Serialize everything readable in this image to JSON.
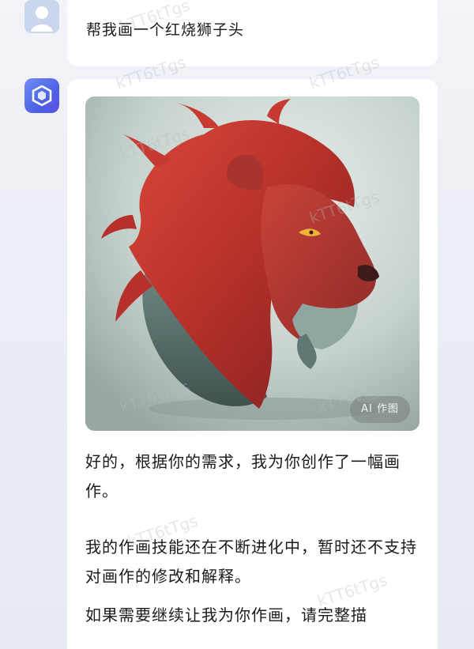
{
  "conversation": {
    "user_message": "帮我画一个红烧狮子头",
    "image_badge": "AI 作图",
    "reply_paragraphs": [
      "好的，根据你的需求，我为你创作了一幅画作。",
      "我的作画技能还在不断进化中，暂时还不支持对画作的修改和解释。",
      "如果需要继续让我为你作画，请完整描"
    ]
  },
  "watermark_text": "kTT6tTgs",
  "colors": {
    "bot_avatar": "#5a6ff0",
    "user_avatar": "#c9d6ec",
    "bubble": "#ffffff",
    "background": "#eceef5"
  },
  "icons": {
    "user_avatar": "person-icon",
    "bot_avatar": "hexagon-logo-icon"
  }
}
